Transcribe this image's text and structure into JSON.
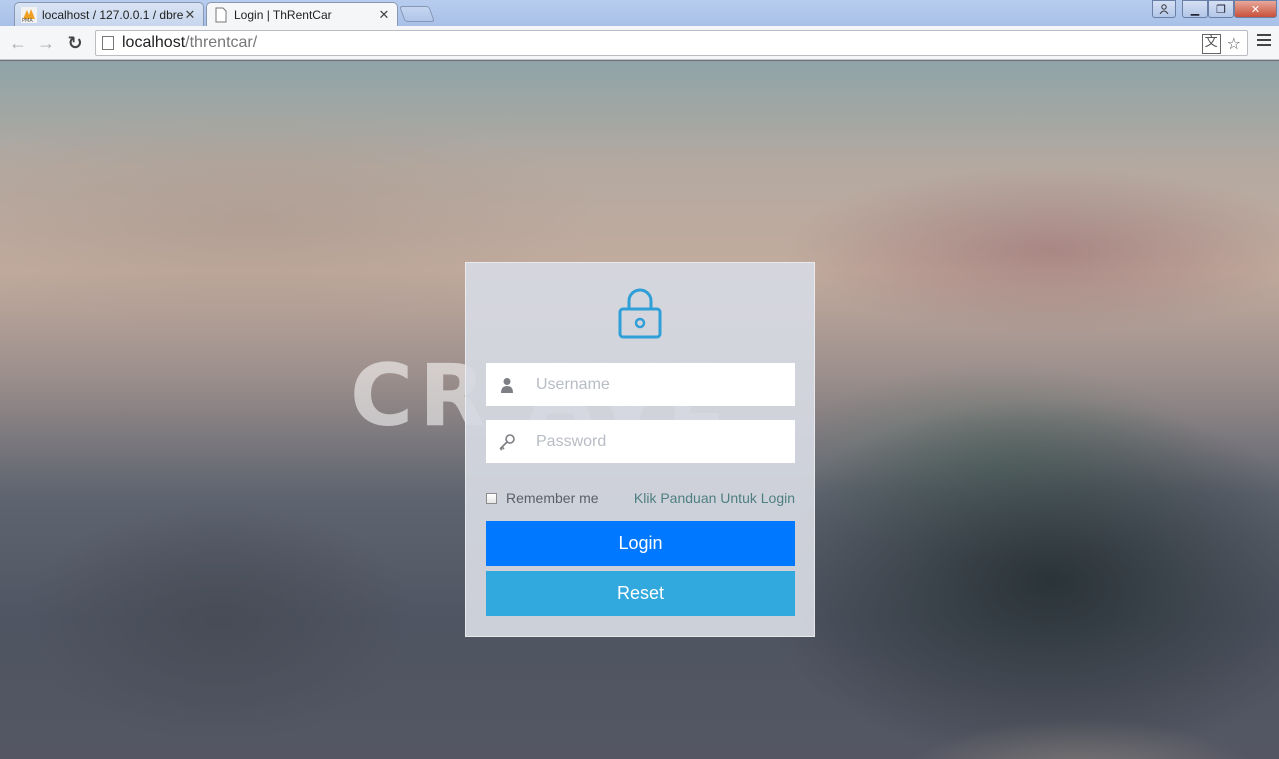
{
  "browser": {
    "tabs": [
      {
        "title": "localhost / 127.0.0.1 / dbre",
        "favicon": "phpmyadmin-icon",
        "active": false
      },
      {
        "title": "Login | ThRentCar",
        "favicon": "page-icon",
        "active": true
      }
    ],
    "url": {
      "host": "localhost",
      "path": "/threntcar/"
    }
  },
  "background": {
    "ghost_text": "CR     AVE"
  },
  "login": {
    "username_placeholder": "Username",
    "password_placeholder": "Password",
    "remember_label": "Remember me",
    "guide_link": "Klik Panduan Untuk Login",
    "login_button": "Login",
    "reset_button": "Reset"
  },
  "colors": {
    "login_button": "#0078ff",
    "reset_button": "#31a9de",
    "lock_icon": "#2f9fd8",
    "link": "#4f7f82"
  }
}
